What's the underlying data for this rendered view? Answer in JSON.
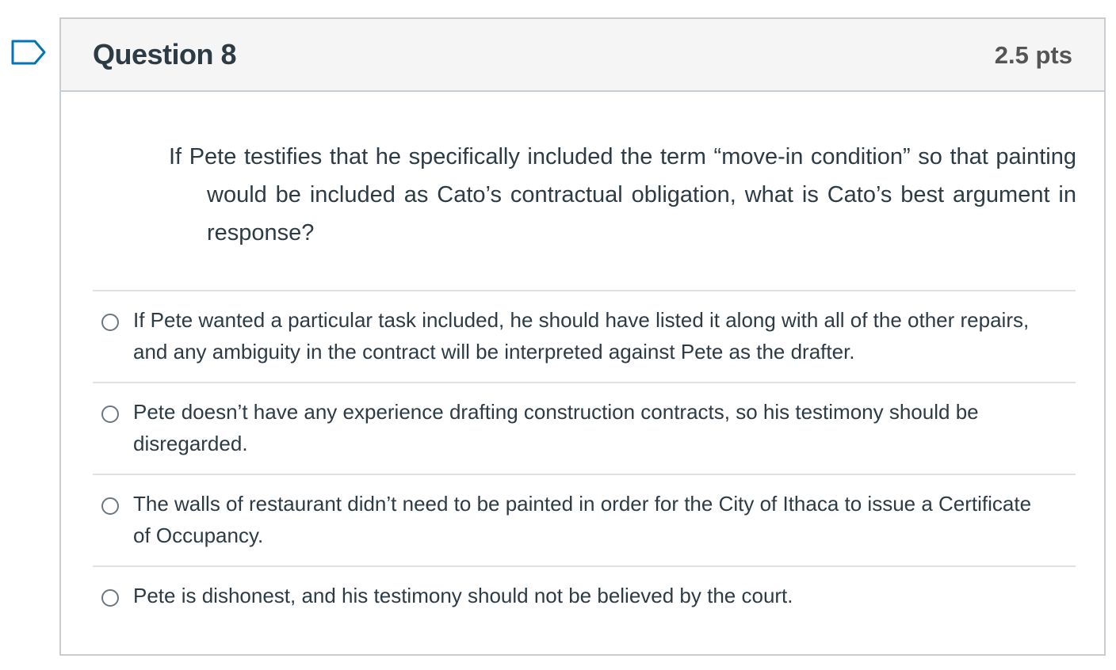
{
  "question": {
    "title": "Question 8",
    "points": "2.5 pts",
    "text": "If Pete testifies that he specifically included the term “move-in condition” so that painting would be included as Cato’s contractual obligation, what is Cato’s best argument in response?"
  },
  "answers": [
    {
      "label": "If Pete wanted a particular task included, he should have listed it along with all of the other repairs, and any ambiguity in the contract will be interpreted against Pete as the drafter."
    },
    {
      "label": "Pete doesn’t have any experience drafting construction contracts, so his testimony should be disregarded."
    },
    {
      "label": "The walls of restaurant didn’t need to be painted in order for the City of Ithaca to issue a Certificate of Occupancy."
    },
    {
      "label": "Pete is dishonest, and his testimony should not be believed by the court."
    }
  ],
  "colors": {
    "border": "#c7cdd1",
    "header_bg": "#f5f5f5",
    "text": "#2d3b45",
    "flag": "#0374b5"
  }
}
